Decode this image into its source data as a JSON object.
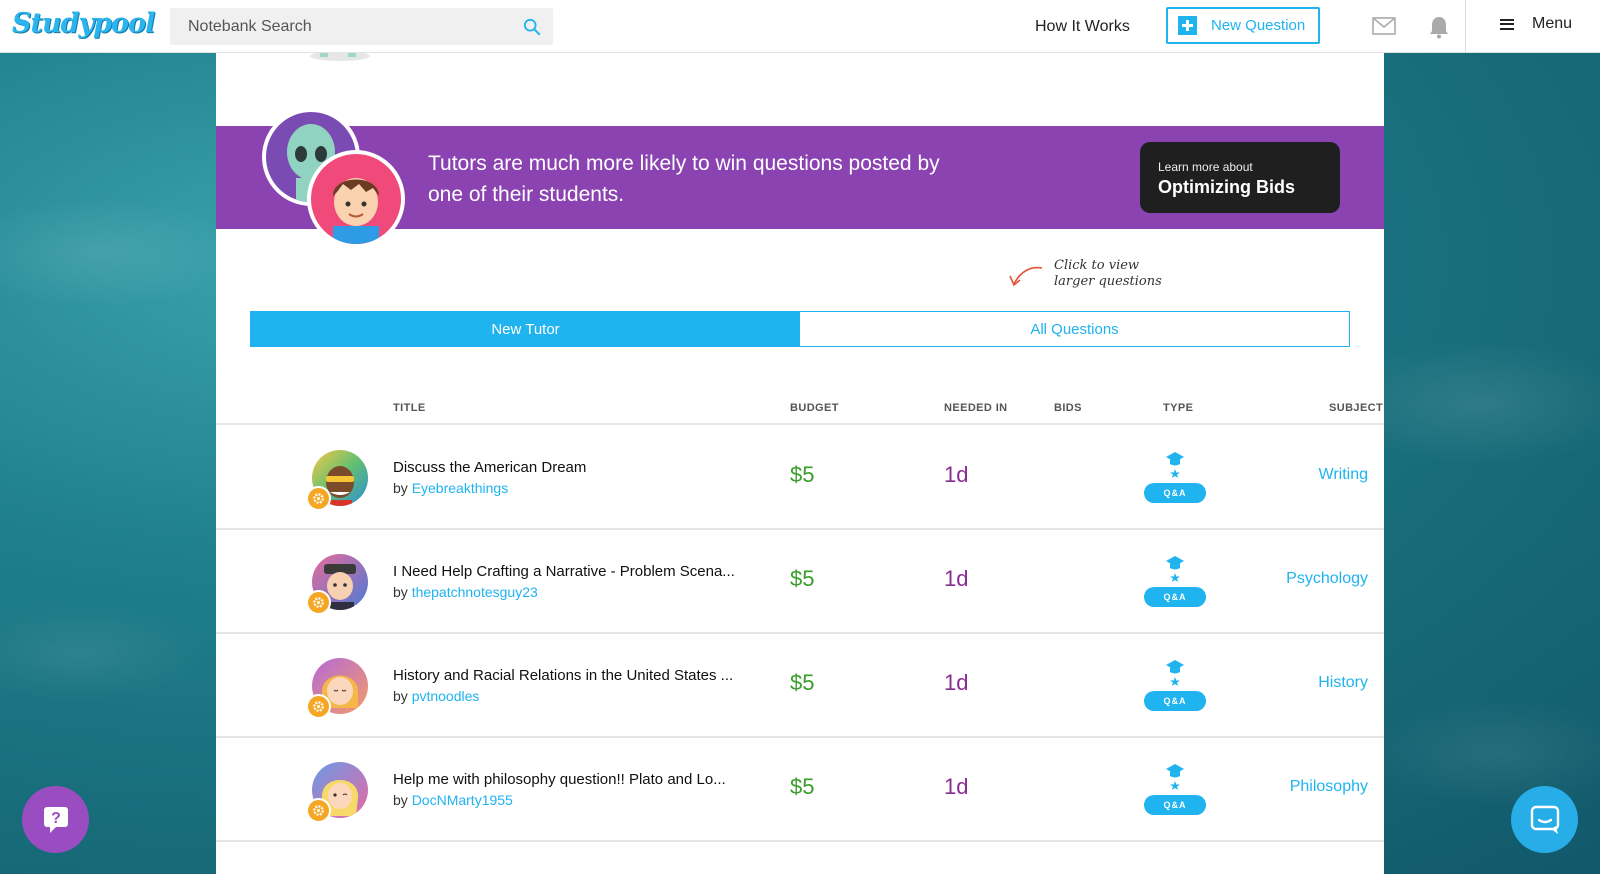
{
  "nav": {
    "logo": "Studypool",
    "search_placeholder": "Notebank Search",
    "how_it_works": "How It Works",
    "new_question": "New Question",
    "menu": "Menu"
  },
  "banner": {
    "message": "Tutors are much more likely to win questions posted by one of their students.",
    "cta_small": "Learn more about",
    "cta_big": "Optimizing Bids"
  },
  "hint": {
    "line1": "Click to view",
    "line2": "larger questions"
  },
  "tabs": [
    {
      "label": "New Tutor",
      "active": true
    },
    {
      "label": "All Questions",
      "active": false
    }
  ],
  "table": {
    "headers": {
      "title": "TITLE",
      "budget": "BUDGET",
      "needed_in": "NEEDED IN",
      "bids": "BIDS",
      "type": "TYPE",
      "subject": "SUBJECT"
    },
    "rows": [
      {
        "title": "Discuss the American Dream",
        "by": "by",
        "author": "Eyebreakthings",
        "budget": "$5",
        "needed_in": "1d",
        "type": "Q&A",
        "subject": "Writing"
      },
      {
        "title": "I Need Help Crafting a Narrative - Problem Scena...",
        "by": "by",
        "author": "thepatchnotesguy23",
        "budget": "$5",
        "needed_in": "1d",
        "type": "Q&A",
        "subject": "Psychology"
      },
      {
        "title": "History and Racial Relations in the United States ...",
        "by": "by",
        "author": "pvtnoodles",
        "budget": "$5",
        "needed_in": "1d",
        "type": "Q&A",
        "subject": "History"
      },
      {
        "title": "Help me with philosophy question!! Plato and Lo...",
        "by": "by",
        "author": "DocNMarty1955",
        "budget": "$5",
        "needed_in": "1d",
        "type": "Q&A",
        "subject": "Philosophy"
      }
    ]
  },
  "colors": {
    "accent": "#1fb3f0",
    "banner": "#8a43b1",
    "budget": "#3a9d2c",
    "needed": "#8a2b96"
  },
  "icons": {
    "search": "search-icon",
    "mail": "mail-icon",
    "bell": "bell-icon",
    "menu": "hamburger-icon",
    "help": "help-icon",
    "chat": "chat-icon"
  }
}
